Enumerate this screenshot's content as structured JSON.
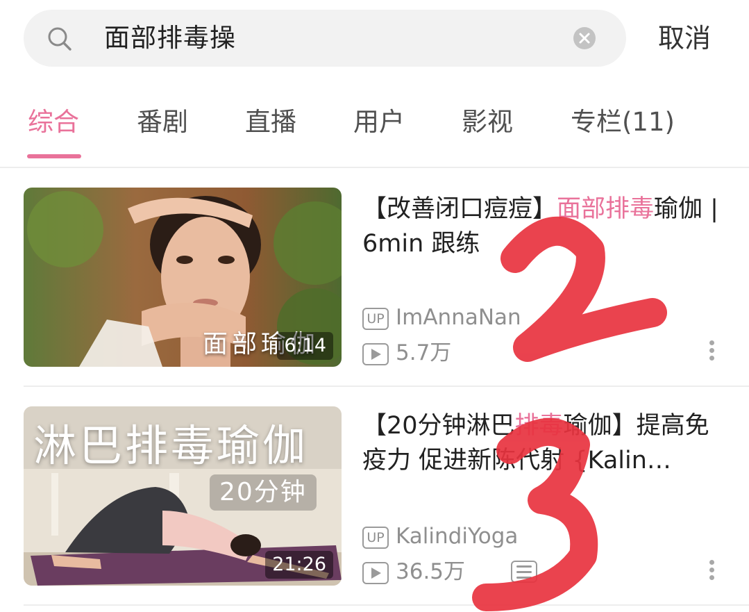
{
  "search": {
    "query": "面部排毒操",
    "cancel_label": "取消"
  },
  "tabs": [
    {
      "label": "综合",
      "active": true
    },
    {
      "label": "番剧",
      "active": false
    },
    {
      "label": "直播",
      "active": false
    },
    {
      "label": "用户",
      "active": false
    },
    {
      "label": "影视",
      "active": false
    },
    {
      "label": "专栏(11)",
      "active": false
    }
  ],
  "results": [
    {
      "title_pre": "【改善闭口痘痘】",
      "title_hl": "面部排毒",
      "title_post": "瑜伽 | 6min 跟练",
      "thumb_caption": "面部瑜伽",
      "duration": "6:14",
      "uploader": "ImAnnaNan",
      "views": "5.7万"
    },
    {
      "title_pre": "【20分钟淋巴",
      "title_hl": "排毒",
      "title_post": "瑜伽】提高免疫力 促进新陈代射 {Kalin…",
      "thumb_caption": "淋巴排毒瑜伽",
      "thumb_sub": "20分钟",
      "duration": "21:26",
      "uploader": "KalindiYoga",
      "views": "36.5万"
    }
  ],
  "badges": {
    "up": "UP"
  },
  "colors": {
    "accent": "#e9729a",
    "annotation": "#e8333f"
  },
  "annotations": [
    "2",
    "3"
  ]
}
